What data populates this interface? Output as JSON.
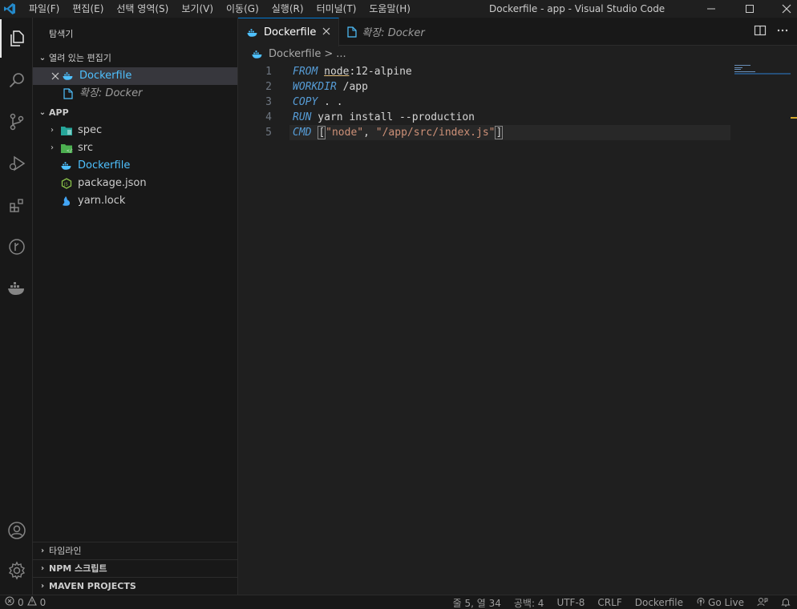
{
  "window": {
    "title": "Dockerfile - app - Visual Studio Code"
  },
  "menu": [
    "파일(F)",
    "편집(E)",
    "선택 영역(S)",
    "보기(V)",
    "이동(G)",
    "실행(R)",
    "터미널(T)",
    "도움말(H)"
  ],
  "sidebar": {
    "title": "탐색기",
    "open_editors_label": "열려 있는 편집기",
    "open_editors": [
      {
        "name": "Dockerfile",
        "icon": "docker-icon"
      },
      {
        "name": "확장: Docker",
        "icon": "file-icon"
      }
    ],
    "folder_label": "APP",
    "tree": [
      {
        "name": "spec",
        "icon": "folder-spec-icon",
        "kind": "folder"
      },
      {
        "name": "src",
        "icon": "folder-src-icon",
        "kind": "folder"
      },
      {
        "name": "Dockerfile",
        "icon": "docker-icon",
        "kind": "file"
      },
      {
        "name": "package.json",
        "icon": "nodejs-icon",
        "kind": "file"
      },
      {
        "name": "yarn.lock",
        "icon": "yarn-icon",
        "kind": "file"
      }
    ],
    "bottom_sections": [
      "타임라인",
      "NPM 스크립트",
      "MAVEN PROJECTS"
    ]
  },
  "tabs": [
    {
      "label": "Dockerfile",
      "active": true
    },
    {
      "label": "확장: Docker",
      "active": false
    }
  ],
  "breadcrumb": {
    "file": "Dockerfile",
    "sep": ">",
    "more": "..."
  },
  "code": {
    "line_numbers": [
      "1",
      "2",
      "3",
      "4",
      "5"
    ],
    "line1": {
      "kw": "FROM",
      "img": "node",
      "rest": ":12-alpine"
    },
    "line2": {
      "kw": "WORKDIR",
      "rest": " /app"
    },
    "line3": {
      "kw": "COPY",
      "rest": " . ."
    },
    "line4": {
      "kw": "RUN",
      "rest": " yarn install --production"
    },
    "line5": {
      "kw": "CMD",
      "open": "[",
      "s1": "\"node\"",
      "comma": ", ",
      "s2": "\"/app/src/index.js\"",
      "close": "]"
    }
  },
  "statusbar": {
    "errors": "0",
    "warnings": "0",
    "position": "줄 5, 열 34",
    "spaces": "공백: 4",
    "encoding": "UTF-8",
    "eol": "CRLF",
    "language": "Dockerfile",
    "golive": "Go Live"
  },
  "colors": {
    "accent": "#0078d4",
    "docker": "#4fc1ff",
    "keyword": "#569cd6",
    "string": "#ce9178"
  }
}
